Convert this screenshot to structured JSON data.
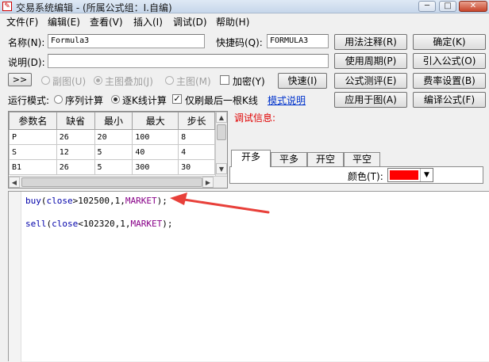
{
  "window": {
    "title": "交易系统编辑 - (所属公式组：I.自编)",
    "min_glyph": "─",
    "max_glyph": "□",
    "close_glyph": "✕"
  },
  "menu": [
    "文件(F)",
    "编辑(E)",
    "查看(V)",
    "插入(I)",
    "调试(D)",
    "帮助(H)"
  ],
  "form": {
    "name_label": "名称(N):",
    "name_value": "Formula3",
    "shortcut_label": "快捷码(Q):",
    "shortcut_value": "FORMULA3",
    "desc_label": "说明(D):",
    "desc_value": "",
    "expand_label": ">>",
    "sub_chart_label": "副图(U)",
    "main_overlay_label": "主图叠加(J)",
    "main_chart_label": "主图(M)",
    "encrypt_label": "加密(Y)",
    "fast_label": "快速(I)",
    "run_mode_label": "运行模式:",
    "seq_calc_label": "序列计算",
    "bar_calc_label": "逐K线计算",
    "last_bar_only_label": "仅刷最后一根K线",
    "mode_help_link": "模式说明"
  },
  "buttons": {
    "usage_notes": "用法注释(R)",
    "ok": "确定(K)",
    "use_period": "使用周期(P)",
    "import_formula": "引入公式(O)",
    "test_formula": "公式测评(E)",
    "fee_settings": "费率设置(B)",
    "apply_to_chart": "应用于图(A)",
    "compile_formula": "编译公式(F)"
  },
  "params": {
    "headers": [
      "参数名",
      "缺省",
      "最小",
      "最大",
      "步长"
    ],
    "rows": [
      [
        "P",
        "26",
        "20",
        "100",
        "8"
      ],
      [
        "S",
        "12",
        "5",
        "40",
        "4"
      ],
      [
        "B1",
        "26",
        "5",
        "300",
        "30"
      ]
    ]
  },
  "debug": {
    "label": "调试信息:"
  },
  "tabs": [
    "开多",
    "平多",
    "开空",
    "平空"
  ],
  "color_picker": {
    "label": "颜色(T):",
    "value_color": "#ff0000"
  },
  "code": {
    "line1": {
      "fn": "buy",
      "open": "(",
      "arg1": "close",
      "op": ">",
      "num": "102500,1,",
      "const": "MARKET",
      "close": ");"
    },
    "line2": {
      "fn": "sell",
      "open": "(",
      "arg1": "close",
      "op": "<",
      "num": "102320,1,",
      "const": "MARKET",
      "close": ");"
    }
  },
  "annotation": {
    "arrow_color": "#e8403a"
  }
}
